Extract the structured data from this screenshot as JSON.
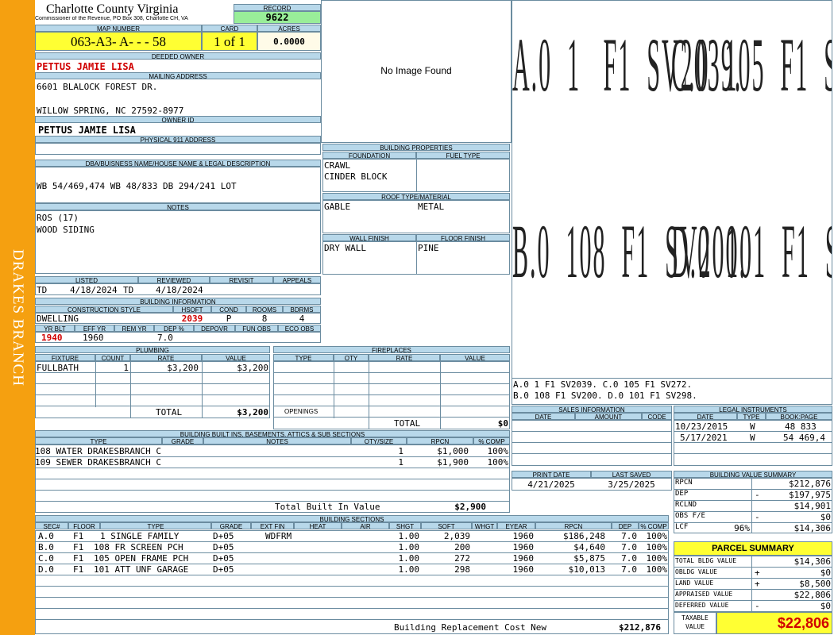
{
  "sidebar_label": "DRAKES BRANCH",
  "county": {
    "name": "Charlotte County Virginia",
    "address": "Commissioner of the Revenue, PO Box 308, Charlotte CH, VA"
  },
  "record": {
    "label": "RECORD",
    "value": "9622"
  },
  "map_number": {
    "label": "MAP NUMBER",
    "value": "063-A3- A-  -  - 58"
  },
  "card": {
    "label": "CARD",
    "value": "1 of 1"
  },
  "acres": {
    "label": "ACRES",
    "value": "0.0000"
  },
  "deeded_owner": {
    "label": "DEEDED OWNER",
    "value": "PETTUS JAMIE LISA"
  },
  "mailing_address": {
    "label": "MAILING ADDRESS",
    "line1": "6601 BLALOCK FOREST DR.",
    "line2": "",
    "line3": "WILLOW SPRING, NC 27592-8977"
  },
  "owner_id": {
    "label": "OWNER ID",
    "value": "PETTUS JAMIE LISA"
  },
  "physical_address": {
    "label": "PHYSICAL 911 ADDRESS",
    "value": ""
  },
  "legal": {
    "label": "DBA/BUISNESS NAME/HOUSE NAME & LEGAL DESCRIPTION",
    "value": "WB 54/469,474 WB 48/833 DB 294/241 LOT"
  },
  "notes": {
    "label": "NOTES",
    "line1": "ROS (17)",
    "line2": "WOOD SIDING"
  },
  "dates": {
    "listed_label": "LISTED",
    "reviewed_label": "REVIEWED",
    "revisit_label": "REVISIT",
    "appeals_label": "APPEALS",
    "listed_by": "TD",
    "listed_date": "4/18/2024",
    "reviewed_by": "TD",
    "reviewed_date": "4/18/2024"
  },
  "building_info": {
    "label": "BUILDING INFORMATION",
    "h": {
      "style": "CONSTRUCTION STYLE",
      "hsqft": "HSQFT",
      "cond": "COND",
      "rooms": "ROOMS",
      "bdrms": "BDRMS",
      "yrblt": "YR BLT",
      "effyr": "EFF YR",
      "remyr": "REM YR",
      "dep": "DEP %",
      "depovr": "DEPOVR",
      "funobs": "FUN OBS",
      "ecoobs": "ECO OBS"
    },
    "style": "DWELLING",
    "hsqft": "2039",
    "cond": "P",
    "rooms": "8",
    "bdrms": "4",
    "yrblt": "1940",
    "effyr": "1960",
    "remyr": "",
    "dep": "7.0",
    "depovr": "",
    "funobs": "",
    "ecoobs": ""
  },
  "no_image": "No Image Found",
  "building_properties": {
    "label": "BUILDING PROPERTIES",
    "foundation_label": "FOUNDATION",
    "fuel_label": "FUEL TYPE",
    "foundation1": "CRAWL",
    "foundation2": "CINDER BLOCK",
    "roof_label": "ROOF TYPE/MATERIAL",
    "roof_type": "GABLE",
    "roof_material": "METAL",
    "wall_label": "WALL FINISH",
    "floor_label": "FLOOR FINISH",
    "wall": "DRY WALL",
    "floor": "PINE"
  },
  "sketch": {
    "row1": "A.0  1   F1  SV2039.",
    "row1b": "C.0  105  F1  SV272.",
    "row2": "B.0  108  F1  SV200.",
    "row2b": "D.0  101  F1  SV298.",
    "legend1": "A.0   1    F1   SV2039.     C.0   105   F1   SV272.",
    "legend2": "B.0   108  F1   SV200.      D.0   101   F1   SV298."
  },
  "plumbing": {
    "label": "PLUMBING",
    "h_fixture": "FIXTURE",
    "h_count": "COUNT",
    "h_rate": "RATE",
    "h_value": "VALUE",
    "rows": [
      {
        "fixture": "FULLBATH",
        "count": "1",
        "rate": "$3,200",
        "value": "$3,200"
      }
    ],
    "total_label": "TOTAL",
    "total": "$3,200"
  },
  "fireplaces": {
    "label": "FIREPLACES",
    "h_type": "TYPE",
    "h_qty": "QTY",
    "h_rate": "RATE",
    "h_value": "VALUE",
    "openings_label": "OPENINGS",
    "total_label": "TOTAL",
    "total": "$0"
  },
  "sales": {
    "label": "SALES INFORMATION",
    "h_date": "DATE",
    "h_amount": "AMOUNT",
    "h_code": "CODE"
  },
  "legal_instruments": {
    "label": "LEGAL INSTRUMENTS",
    "h_date": "DATE",
    "h_type": "TYPE",
    "h_book": "BOOK:PAGE",
    "rows": [
      {
        "date": "10/23/2015",
        "type": "W",
        "book": "48 833"
      },
      {
        "date": "5/17/2021",
        "type": "W",
        "book": "54 469,4"
      }
    ]
  },
  "builtins": {
    "label": "BUILDING BUILT INS, BASEMENTS, ATTICS & SUB SECTIONS",
    "h_type": "TYPE",
    "h_grade": "GRADE",
    "h_notes": "NOTES",
    "h_qty": "QTY/SIZE",
    "h_rpcn": "RPCN",
    "h_comp": "% COMP",
    "rows": [
      {
        "type": "108 WATER DRAKESBRANCH C",
        "qty": "1",
        "rpcn": "$1,000",
        "comp": "100%"
      },
      {
        "type": "109 SEWER DRAKESBRANCH C",
        "qty": "1",
        "rpcn": "$1,900",
        "comp": "100%"
      }
    ],
    "total_label": "Total Built In Value",
    "total": "$2,900"
  },
  "print": {
    "print_label": "PRINT DATE",
    "saved_label": "LAST SAVED",
    "print_date": "4/21/2025",
    "last_saved": "3/25/2025"
  },
  "value_summary": {
    "label": "BUILDING VALUE SUMMARY",
    "rows": [
      {
        "k": "RPCN",
        "s": "",
        "v": "$212,876"
      },
      {
        "k": "DEP",
        "s": "-",
        "v": "$197,975"
      },
      {
        "k": "RCLND",
        "s": "",
        "v": "$14,901"
      },
      {
        "k": "OBS F/E",
        "s": "-",
        "v": "$0"
      },
      {
        "k": "LCF",
        "pct": "96%",
        "s": "",
        "v": "$14,306"
      }
    ]
  },
  "parcel_summary": {
    "label": "PARCEL SUMMARY",
    "rows": [
      {
        "k": "TOTAL BLDG VALUE",
        "s": "",
        "v": "$14,306"
      },
      {
        "k": "OBLDG VALUE",
        "s": "+",
        "v": "$0"
      },
      {
        "k": "LAND VALUE",
        "s": "+",
        "v": "$8,500"
      },
      {
        "k": "APPRAISED VALUE",
        "s": "",
        "v": "$22,806"
      },
      {
        "k": "DEFERRED VALUE",
        "s": "-",
        "v": "$0"
      }
    ],
    "taxable_label1": "TAXABLE",
    "taxable_label2": "VALUE",
    "taxable": "$22,806"
  },
  "sections": {
    "label": "BUILDING SECTIONS",
    "h": {
      "sec": "SEC#",
      "floor": "FLOOR",
      "type": "TYPE",
      "grade": "GRADE",
      "extfin": "EXT FIN",
      "heat": "HEAT",
      "air": "AIR",
      "shgt": "SHGT",
      "sqft": "SQFT",
      "whgt": "WHGT",
      "eyear": "EYEAR",
      "rpcn": "RPCN",
      "dep": "DEP",
      "comp": "% COMP"
    },
    "rows": [
      {
        "sec": "A.0",
        "floor": "F1",
        "type": "1 SINGLE FAMILY",
        "grade": "D+05",
        "extfin": "WDFRM",
        "shgt": "1.00",
        "sqft": "2,039",
        "eyear": "1960",
        "rpcn": "$186,248",
        "dep": "7.0",
        "comp": "100%"
      },
      {
        "sec": "B.0",
        "floor": "F1",
        "type": "108 FR SCREEN PCH",
        "grade": "D+05",
        "extfin": "",
        "shgt": "1.00",
        "sqft": "200",
        "eyear": "1960",
        "rpcn": "$4,640",
        "dep": "7.0",
        "comp": "100%"
      },
      {
        "sec": "C.0",
        "floor": "F1",
        "type": "105 OPEN FRAME PCH",
        "grade": "D+05",
        "extfin": "",
        "shgt": "1.00",
        "sqft": "272",
        "eyear": "1960",
        "rpcn": "$5,875",
        "dep": "7.0",
        "comp": "100%"
      },
      {
        "sec": "D.0",
        "floor": "F1",
        "type": "101 ATT UNF GARAGE",
        "grade": "D+05",
        "extfin": "",
        "shgt": "1.00",
        "sqft": "298",
        "eyear": "1960",
        "rpcn": "$10,013",
        "dep": "7.0",
        "comp": "100%"
      }
    ],
    "total_label": "Building Replacement Cost New",
    "total": "$212,876"
  },
  "colors": {
    "sidebar": "#f5a010",
    "header_band": "#b8d8ea",
    "highlight": "#ffff33",
    "record": "#99ee99",
    "accent_red": "#d00000"
  }
}
